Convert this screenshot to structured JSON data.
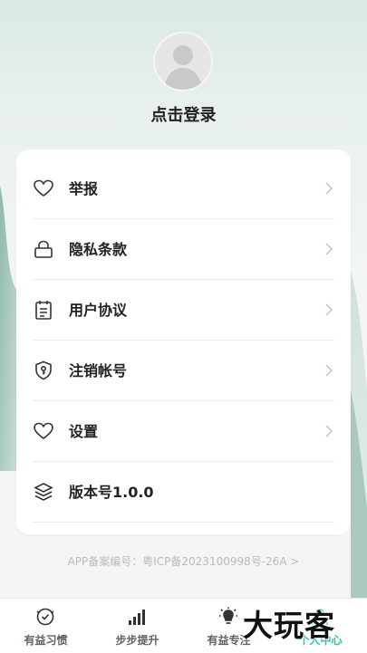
{
  "profile": {
    "login_label": "点击登录"
  },
  "menu": [
    {
      "label": "举报",
      "icon": "heart-icon"
    },
    {
      "label": "隐私条款",
      "icon": "lock-icon"
    },
    {
      "label": "用户协议",
      "icon": "document-icon"
    },
    {
      "label": "注销帐号",
      "icon": "shield-key-icon"
    },
    {
      "label": "设置",
      "icon": "heart-icon"
    },
    {
      "label": "版本号1.0.0",
      "icon": "layers-icon"
    }
  ],
  "footer": {
    "icp": "APP备案编号：粤ICP备2023100998号-26A >"
  },
  "tabbar": [
    {
      "label": "有益习惯",
      "icon": "habit-icon"
    },
    {
      "label": "步步提升",
      "icon": "signal-bars-icon"
    },
    {
      "label": "有益专注",
      "icon": "lightbulb-icon"
    },
    {
      "label": "个人中心",
      "icon": "person-icon",
      "active": true
    }
  ],
  "watermark": {
    "text": "大玩客"
  },
  "colors": {
    "accent": "#2ec1a8",
    "background": "#f4f6f5"
  }
}
